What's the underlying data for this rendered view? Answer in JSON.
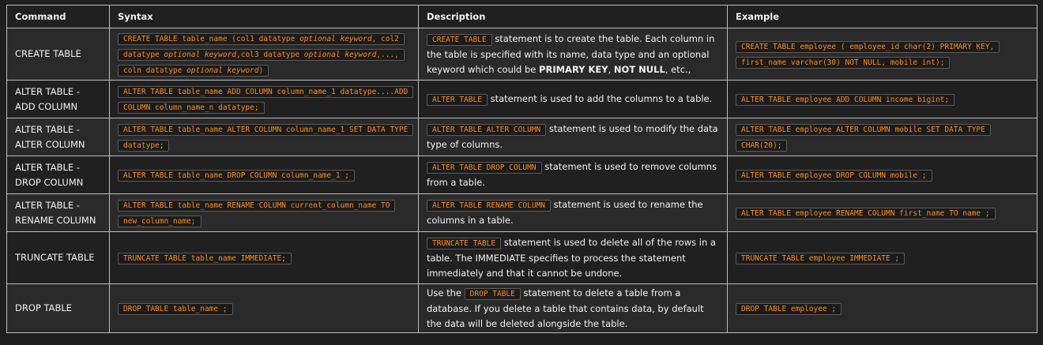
{
  "headers": [
    "Command",
    "Syntax",
    "Description",
    "Example"
  ],
  "rows": [
    {
      "command": "CREATE TABLE",
      "syntax": {
        "p1": "CREATE TABLE table_name (col1 datatype ",
        "i1": "optional keyword",
        "p2": ", col2 datatype ",
        "i2": "optional keyword",
        "p3": ",col3 datatype ",
        "i3": "optional keyword",
        "p4": ",..., coln datatype ",
        "i4": "optional keyword",
        "p5": ")"
      },
      "desc": {
        "code": "CREATE TABLE",
        "text1": " statement is to create the table. Each column in the table is specified with its name, data type and an optional keyword which could be ",
        "b1": "PRIMARY KEY",
        "text2": ", ",
        "b2": "NOT NULL",
        "text3": ", etc.,"
      },
      "example": "CREATE TABLE employee ( employee_id char(2) PRIMARY KEY, first_name varchar(30) NOT NULL, mobile int);"
    },
    {
      "command": "ALTER TABLE - ADD COLUMN",
      "syntax": "ALTER TABLE table_name ADD COLUMN column_name_1 datatype....ADD COLUMN column_name_n datatype;",
      "desc": {
        "code": "ALTER TABLE",
        "text": " statement is used to add the columns to a table."
      },
      "example": "ALTER TABLE employee ADD COLUMN income bigint;"
    },
    {
      "command": "ALTER TABLE - ALTER COLUMN",
      "syntax": "ALTER TABLE table_name ALTER COLUMN column_name_1 SET DATA TYPE datatype;",
      "desc": {
        "code": "ALTER TABLE ALTER COLUMN",
        "text": " statement is used to modify the data type of columns."
      },
      "example": "ALTER TABLE employee ALTER COLUMN mobile SET DATA TYPE CHAR(20);"
    },
    {
      "command": "ALTER TABLE - DROP COLUMN",
      "syntax": "ALTER TABLE table_name DROP COLUMN column_name_1 ;",
      "desc": {
        "code": "ALTER TABLE DROP COLUMN",
        "text": " statement is used to remove columns from a table."
      },
      "example": "ALTER TABLE employee DROP COLUMN mobile ;"
    },
    {
      "command": "ALTER TABLE - RENAME COLUMN",
      "syntax": "ALTER TABLE table_name RENAME COLUMN current_column_name TO new_column_name;",
      "desc": {
        "code": "ALTER TABLE RENAME COLUMN",
        "text": " statement is used to rename the columns in a table."
      },
      "example": "ALTER TABLE employee RENAME COLUMN first_name TO name ;"
    },
    {
      "command": "TRUNCATE TABLE",
      "syntax": "TRUNCATE TABLE table_name IMMEDIATE;",
      "desc": {
        "code": "TRUNCATE TABLE",
        "text": " statement is used to delete all of the rows in a table. The IMMEDIATE specifies to process the statement immediately and that it cannot be undone."
      },
      "example": "TRUNCATE TABLE employee IMMEDIATE ;"
    },
    {
      "command": "DROP TABLE",
      "syntax": "DROP TABLE table_name ;",
      "desc": {
        "pre": "Use the ",
        "code": "DROP TABLE",
        "text": " statement to delete a table from a database. If you delete a table that contains data, by default the data will be deleted alongside the table."
      },
      "example": "DROP TABLE employee ;"
    }
  ]
}
